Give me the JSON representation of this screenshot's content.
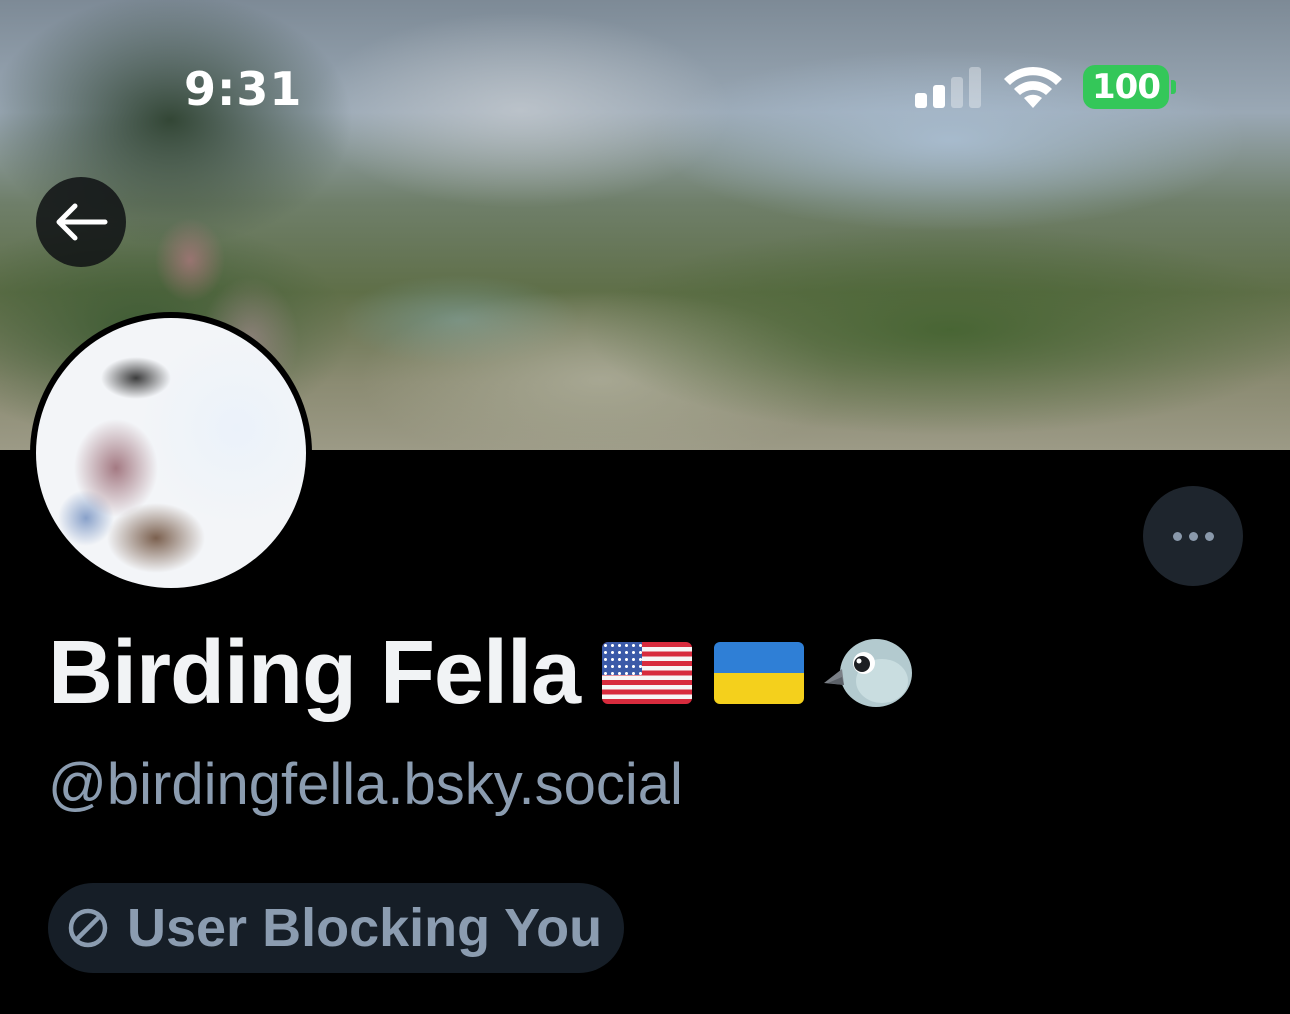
{
  "status_bar": {
    "time": "9:31",
    "battery_level": "100",
    "battery_color": "#34c759",
    "signal_bars_active": 2,
    "signal_bars_total": 4,
    "icons": [
      "cellular-signal-icon",
      "wifi-icon",
      "battery-icon"
    ]
  },
  "header": {
    "back_icon": "back-arrow-icon"
  },
  "profile": {
    "display_name": "Birding Fella",
    "name_emojis": [
      "us-flag-emoji",
      "ukraine-flag-emoji",
      "bird-emoji"
    ],
    "handle": "@birdingfella.bsky.social",
    "more_icon": "ellipsis-icon"
  },
  "block_status": {
    "icon": "ban-icon",
    "label": "User Blocking You"
  },
  "colors": {
    "background": "#000000",
    "display_name": "#f1f3f5",
    "muted_text": "#8b9cb0",
    "badge_background": "#161e27",
    "more_button_background": "#1e252d"
  }
}
